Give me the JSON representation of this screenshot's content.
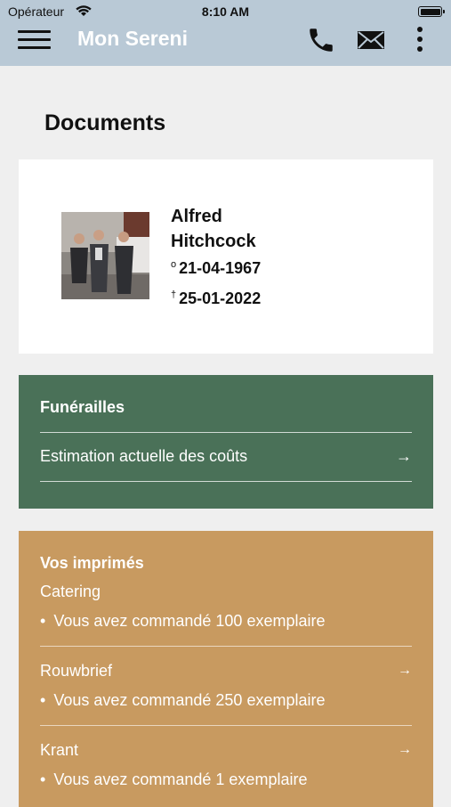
{
  "status": {
    "carrier": "Opérateur",
    "time": "8:10 AM"
  },
  "header": {
    "title": "Mon Sereni"
  },
  "page": {
    "title": "Documents"
  },
  "person": {
    "first_name": "Alfred",
    "last_name": "Hitchcock",
    "birth_symbol": "o",
    "birth": "21-04-1967",
    "death_symbol": "†",
    "death": "25-01-2022"
  },
  "funeral": {
    "heading": "Funérailles",
    "row_label": "Estimation actuelle des coûts",
    "arrow": "→"
  },
  "prints": {
    "heading": "Vos imprimés",
    "items": [
      {
        "title": "Catering",
        "bullet": "Vous avez commandé 100 exemplaire",
        "arrow": ""
      },
      {
        "title": "Rouwbrief",
        "bullet": "Vous avez commandé 250 exemplaire",
        "arrow": "→"
      },
      {
        "title": "Krant",
        "bullet": "Vous avez commandé 1 exemplaire",
        "arrow": "→"
      }
    ]
  },
  "colors": {
    "header_bg": "#b9c9d6",
    "funeral_bg": "#4a7158",
    "prints_bg": "#c89a60"
  }
}
